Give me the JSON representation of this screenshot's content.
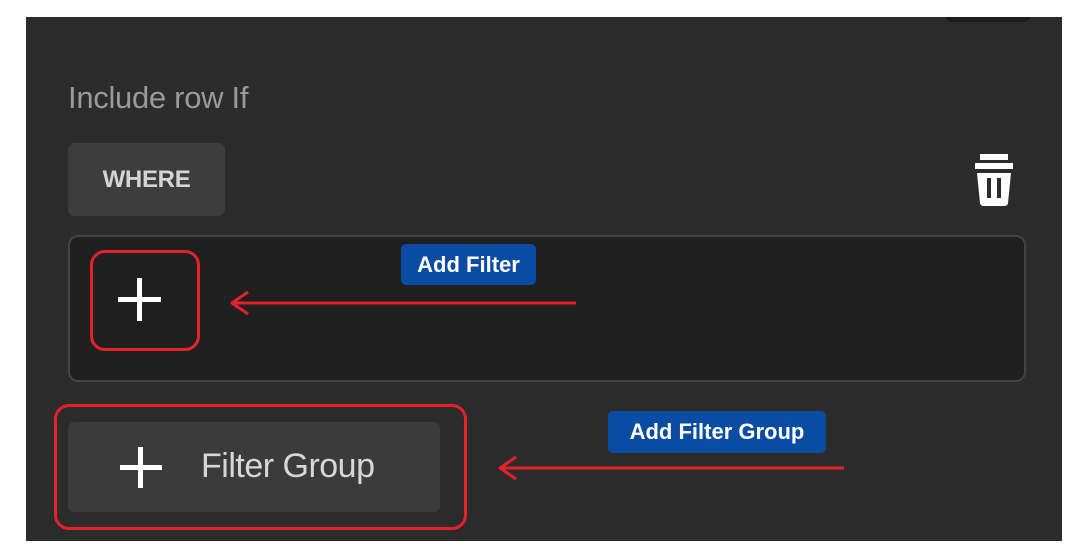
{
  "section": {
    "label": "Include row If",
    "where_chip": "WHERE"
  },
  "icons": {
    "delete": "trash-icon",
    "add": "plus-icon"
  },
  "buttons": {
    "filter_group_label": "Filter Group"
  },
  "annotations": {
    "add_filter": "Add Filter",
    "add_filter_group": "Add Filter Group"
  },
  "colors": {
    "panel": "#2b2b2b",
    "highlight": "#e5222a",
    "callout": "#0a4ba3"
  }
}
